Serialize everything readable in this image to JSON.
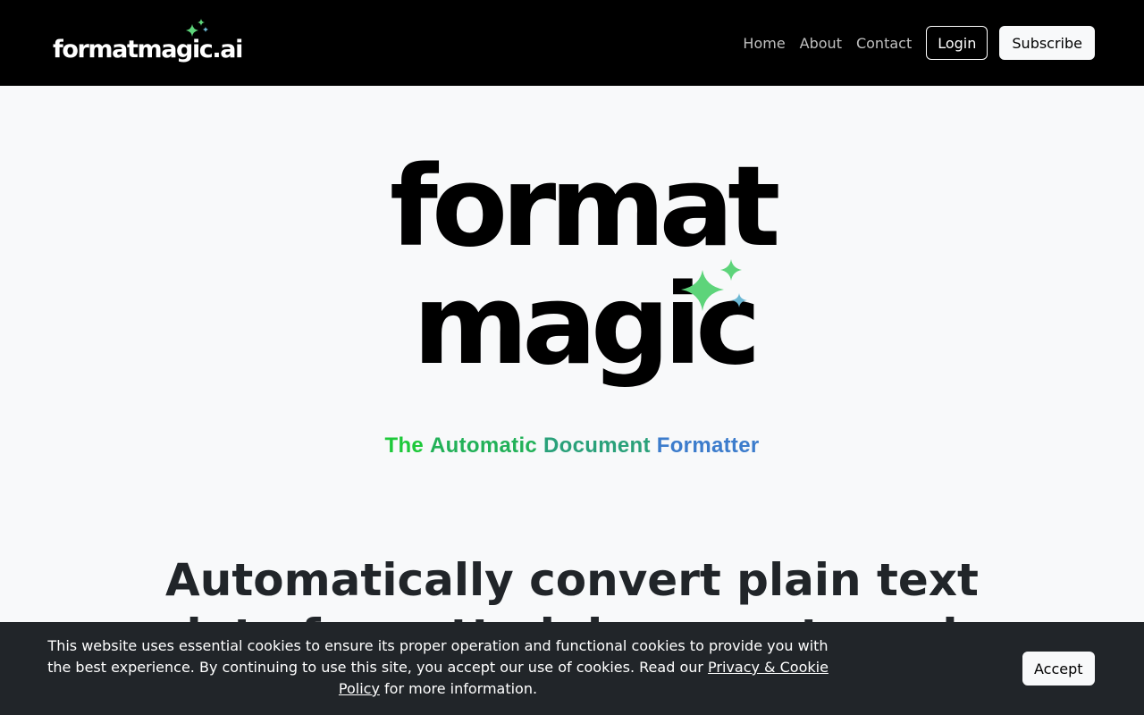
{
  "navbar": {
    "brand": "formatmagic.ai",
    "brand_icon": "sparkles-icon",
    "links": [
      "Home",
      "About",
      "Contact"
    ],
    "login_label": "Login",
    "subscribe_label": "Subscribe"
  },
  "hero": {
    "logo_line1": "format",
    "logo_line2": "magic",
    "logo_icon": "sparkles-icon",
    "tagline_words": [
      "The",
      "Automatic",
      "Document",
      "Formatter"
    ]
  },
  "headline": "Automatically convert plain text into formatted documents and",
  "cookie": {
    "text_before": "This website uses essential cookies to ensure its proper operation and functional cookies to provide you with the best experience. By continuing to use this site, you accept our use of cookies. Read our ",
    "link_text": "Privacy & Cookie Policy",
    "text_after": " for more information.",
    "accept_label": "Accept"
  },
  "colors": {
    "navbar_bg": "#000000",
    "page_bg": "#f8f9fa",
    "banner_bg": "#212529",
    "sparkle_green": "#5dd47a",
    "sparkle_teal": "#6cb8d4",
    "tagline_green": "#1ec93a",
    "tagline_blue": "#3c7ccc"
  }
}
